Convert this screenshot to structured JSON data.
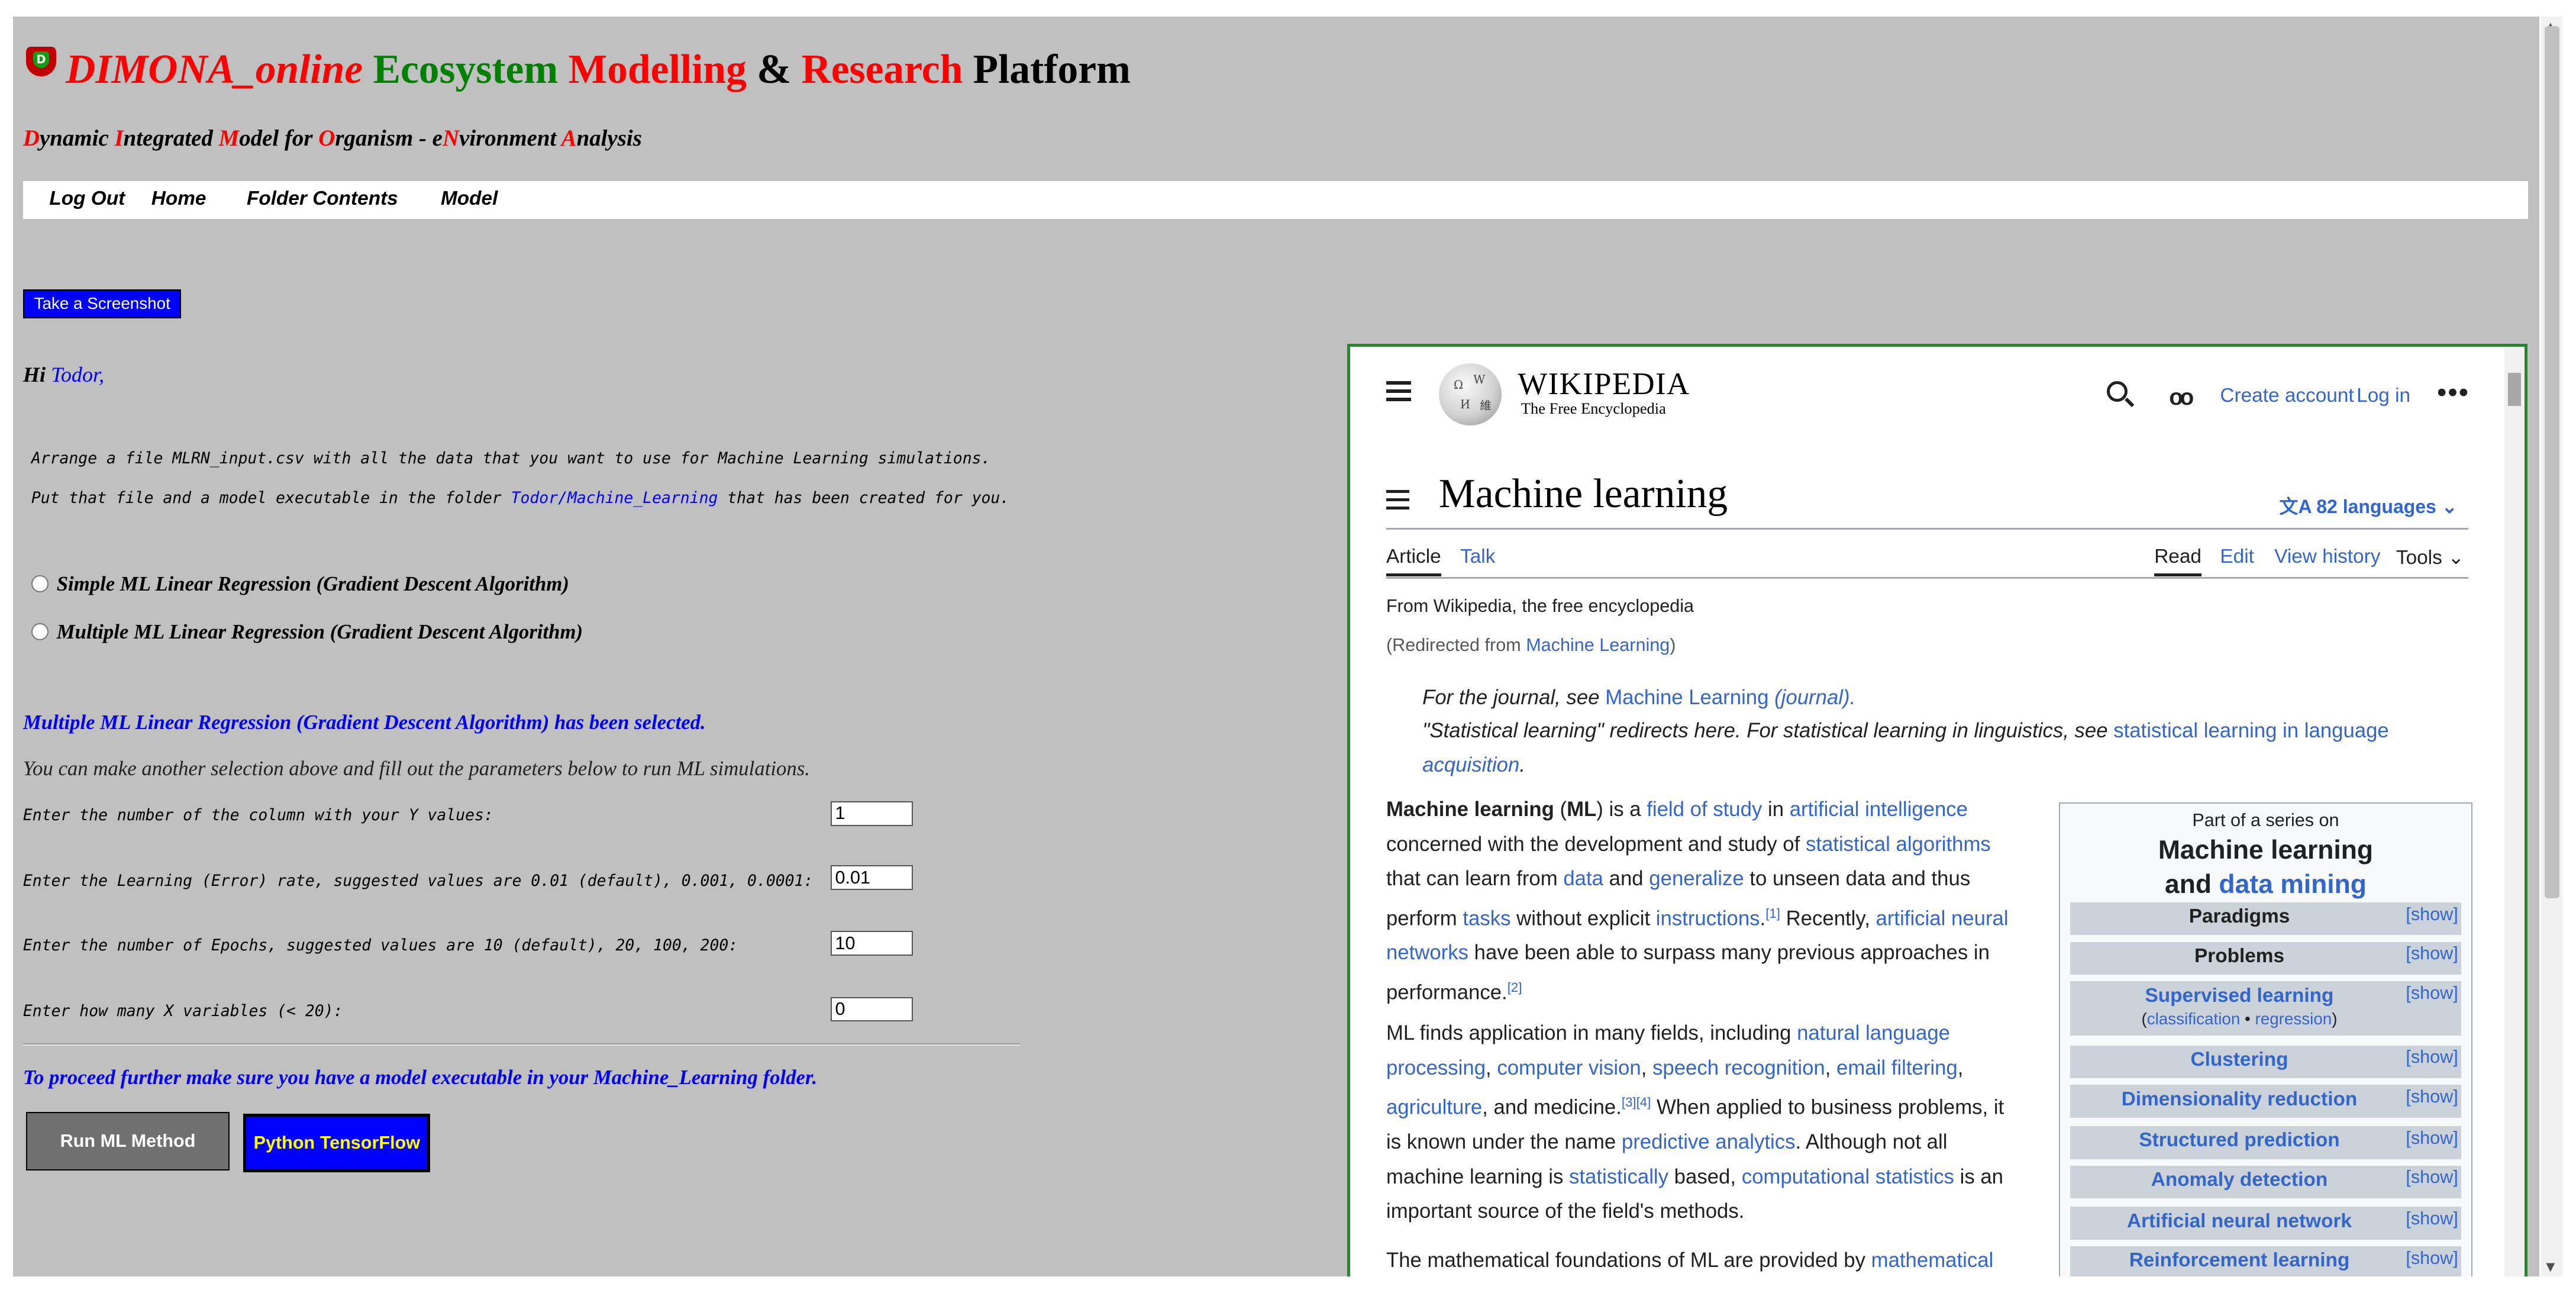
{
  "header": {
    "title_parts": [
      "DIMONA_online",
      "Ecosystem",
      "Modelling",
      "&",
      "Research",
      "Platform"
    ],
    "logo_letter": "D",
    "subtitle_letters": [
      "D",
      "I",
      "M",
      "O",
      "e",
      "N",
      "A"
    ],
    "subtitle_rest": [
      "ynamic ",
      "ntegrated ",
      "odel for ",
      "rganism - ",
      "",
      "vironment ",
      "nalysis"
    ]
  },
  "menu": [
    "Log Out",
    "Home",
    "Folder Contents",
    "Model"
  ],
  "screenshot_button": "Take a Screenshot",
  "greeting": {
    "hi": "Hi",
    "user": "Todor,"
  },
  "instructions": {
    "line1": "Arrange a file MLRN_input.csv with all the data that you want to use for Machine Learning simulations.",
    "line2_a": "Put that file and a model executable in the folder ",
    "line2_link": "Todor/Machine_Learning",
    "line2_b": " that has been created for you."
  },
  "options": [
    "Simple ML Linear Regression (Gradient Descent Algorithm)",
    "Multiple ML Linear Regression (Gradient Descent Algorithm)"
  ],
  "selected_message": "Multiple ML Linear Regression (Gradient Descent Algorithm) has been selected.",
  "another_selection": "You can make another selection above and fill out the parameters below to run ML simulations.",
  "params": [
    {
      "label": "Enter the number of the column with your Y values:",
      "value": "1"
    },
    {
      "label": "Enter the Learning (Error) rate, suggested values are 0.01 (default), 0.001, 0.0001:",
      "value": "0.01"
    },
    {
      "label": "Enter the number of Epochs, suggested values are 10 (default), 20, 100, 200:",
      "value": "10"
    },
    {
      "label": "Enter how many X variables (< 20):",
      "value": "0"
    }
  ],
  "proceed_note": "To proceed further make sure you have a model executable in your Machine_Learning folder.",
  "buttons": {
    "run": "Run ML Method",
    "tensorflow": "Python TensorFlow"
  },
  "wiki": {
    "wordmark": "WIKIPEDIA",
    "tagline": "The Free Encyclopedia",
    "create_account": "Create account",
    "log_in": "Log in",
    "page_title": "Machine learning",
    "languages": "82 languages",
    "tabs": {
      "article": "Article",
      "talk": "Talk",
      "read": "Read",
      "edit": "Edit",
      "view_history": "View history",
      "tools": "Tools"
    },
    "from": "From Wikipedia, the free encyclopedia",
    "redirect_a": "(Redirected from ",
    "redirect_link": "Machine Learning",
    "redirect_b": ")",
    "hatnote1_a": "For the journal, see ",
    "hatnote1_link": "Machine Learning",
    "hatnote1_b": " (journal).",
    "hatnote2_a": "\"Statistical learning\" redirects here. For statistical learning in linguistics, see ",
    "hatnote2_link1": "statistical learning in language",
    "hatnote2_link2": "acquisition",
    "hatnote2_b": ".",
    "para1": [
      {
        "t": "Machine learning",
        "b": true
      },
      {
        "t": " ("
      },
      {
        "t": "ML",
        "b": true
      },
      {
        "t": ") is a "
      },
      {
        "t": "field of study",
        "l": true
      },
      {
        "t": " in "
      },
      {
        "t": "artificial intelligence",
        "l": true
      },
      {
        "br": true
      },
      {
        "t": "concerned with the development and study of "
      },
      {
        "t": "statistical algorithms",
        "l": true
      },
      {
        "br": true
      },
      {
        "t": "that can learn from "
      },
      {
        "t": "data",
        "l": true
      },
      {
        "t": " and "
      },
      {
        "t": "generalize",
        "l": true
      },
      {
        "t": " to unseen data and thus"
      },
      {
        "br": true
      },
      {
        "t": "perform "
      },
      {
        "t": "tasks",
        "l": true
      },
      {
        "t": " without explicit "
      },
      {
        "t": "instructions",
        "l": true
      },
      {
        "t": ".",
        "": 0
      },
      {
        "t": "[1]",
        "sup": true
      },
      {
        "t": " Recently, "
      },
      {
        "t": "artificial neural",
        "l": true
      },
      {
        "br": true
      },
      {
        "t": "networks",
        "l": true
      },
      {
        "t": " have been able to surpass many previous approaches in"
      },
      {
        "br": true
      },
      {
        "t": "performance."
      },
      {
        "t": "[2]",
        "sup": true
      }
    ],
    "para2": [
      {
        "t": "ML finds application in many fields, including "
      },
      {
        "t": "natural language",
        "l": true
      },
      {
        "br": true
      },
      {
        "t": "processing",
        "l": true
      },
      {
        "t": ", "
      },
      {
        "t": "computer vision",
        "l": true
      },
      {
        "t": ", "
      },
      {
        "t": "speech recognition",
        "l": true
      },
      {
        "t": ", "
      },
      {
        "t": "email filtering",
        "l": true
      },
      {
        "t": ","
      },
      {
        "br": true
      },
      {
        "t": "agriculture",
        "l": true
      },
      {
        "t": ", and medicine."
      },
      {
        "t": "[3][4]",
        "sup": true
      },
      {
        "t": " When applied to business problems, it"
      },
      {
        "br": true
      },
      {
        "t": "is known under the name "
      },
      {
        "t": "predictive analytics",
        "l": true
      },
      {
        "t": ". Although not all"
      },
      {
        "br": true
      },
      {
        "t": "machine learning is "
      },
      {
        "t": "statistically",
        "l": true
      },
      {
        "t": " based, "
      },
      {
        "t": "computational statistics",
        "l": true
      },
      {
        "t": " is an"
      },
      {
        "br": true
      },
      {
        "t": "important source of the field's methods."
      }
    ],
    "para3_a": "The mathematical foundations of ML are provided by ",
    "para3_link": "mathematical",
    "infobox": {
      "part_of": "Part of a series on",
      "title1": "Machine learning",
      "title2a": "and ",
      "title2b": "data mining",
      "show": "[show]",
      "rows": [
        "Paradigms",
        "Problems",
        "Supervised learning",
        "Clustering",
        "Dimensionality reduction",
        "Structured prediction",
        "Anomaly detection",
        "Artificial neural network",
        "Reinforcement learning"
      ],
      "supervised_sub_a": "(",
      "supervised_sub_l1": "classification",
      "supervised_sub_m": " • ",
      "supervised_sub_l2": "regression",
      "supervised_sub_b": ")"
    }
  }
}
